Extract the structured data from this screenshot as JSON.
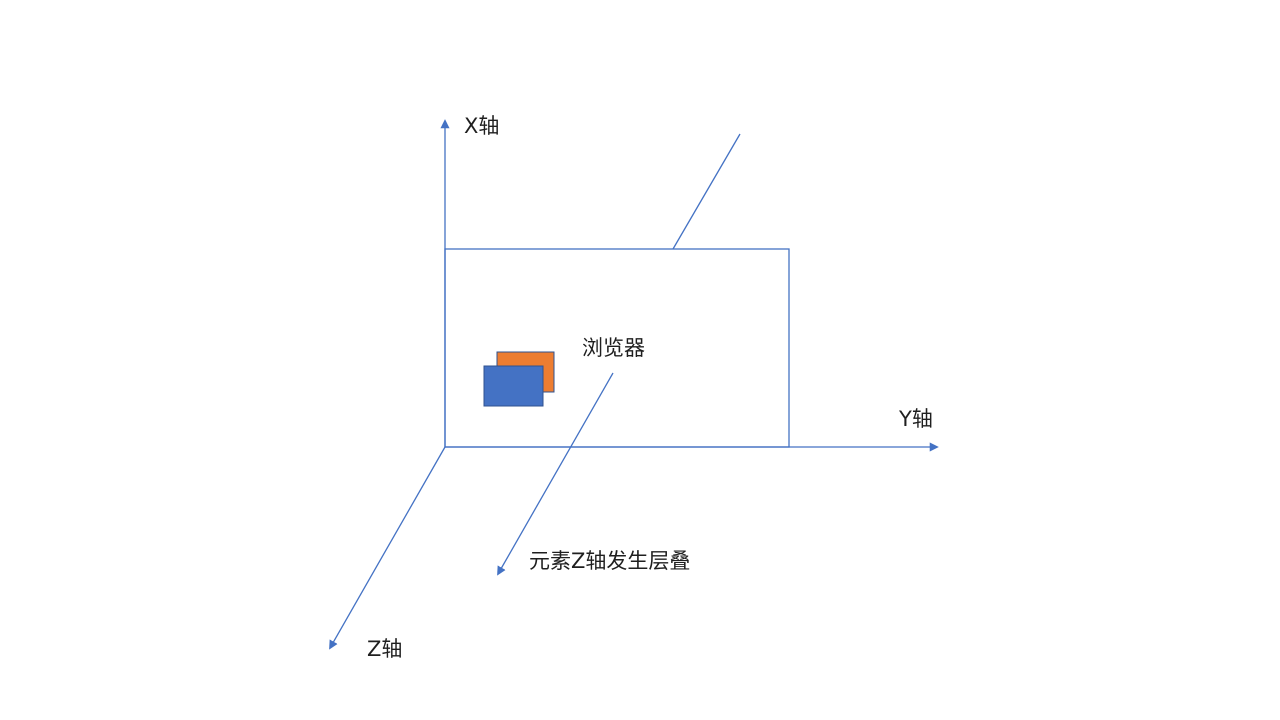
{
  "labels": {
    "x_axis": "X轴",
    "y_axis": "Y轴",
    "z_axis": "Z轴",
    "browser": "浏览器",
    "stacking_note": "元素Z轴发生层叠"
  },
  "colors": {
    "axis_line": "#4472c4",
    "browser_box_stroke": "#4472c4",
    "back_element_fill": "#ed7d31",
    "front_element_fill": "#4472c4",
    "element_stroke": "#2f528f",
    "text": "#1f1f1f"
  }
}
